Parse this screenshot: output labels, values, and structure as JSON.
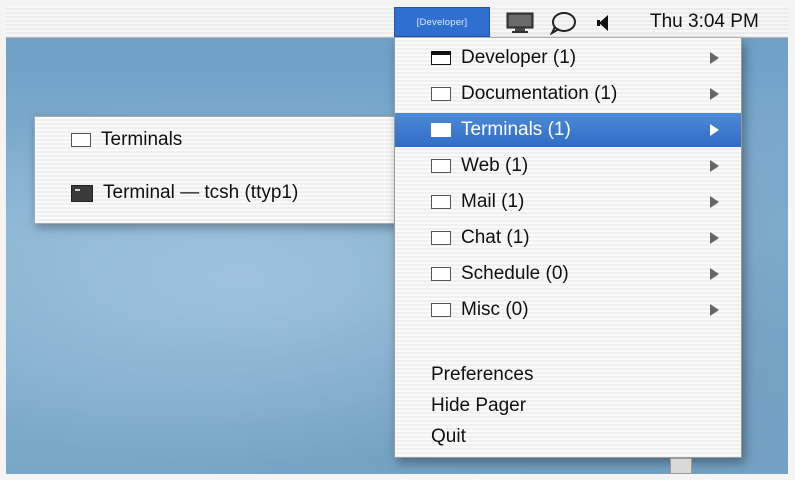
{
  "menubar": {
    "pager_label": "[Developer]",
    "clock": "Thu 3:04 PM",
    "icons": [
      "display-icon",
      "speech-bubble-icon",
      "volume-icon"
    ]
  },
  "menu": {
    "items": [
      {
        "label": "Developer (1)",
        "icon": "window-active-icon",
        "has_submenu": true
      },
      {
        "label": "Documentation (1)",
        "icon": "window-icon",
        "has_submenu": true
      },
      {
        "label": "Terminals (1)",
        "icon": "window-icon",
        "has_submenu": true,
        "selected": true
      },
      {
        "label": "Web (1)",
        "icon": "window-icon",
        "has_submenu": true
      },
      {
        "label": "Mail (1)",
        "icon": "window-icon",
        "has_submenu": true
      },
      {
        "label": "Chat (1)",
        "icon": "window-icon",
        "has_submenu": true
      },
      {
        "label": "Schedule (0)",
        "icon": "window-icon",
        "has_submenu": true
      },
      {
        "label": "Misc (0)",
        "icon": "window-icon",
        "has_submenu": true
      }
    ],
    "actions": [
      "Preferences",
      "Hide Pager",
      "Quit"
    ]
  },
  "submenu": {
    "header": "Terminals",
    "items": [
      {
        "label": "Terminal — tcsh (ttyp1)",
        "icon": "terminal-icon"
      }
    ]
  },
  "colors": {
    "selection": "#3f7ccf",
    "desktop": "#7fa9c9",
    "pager_tag": "#2f6fd0"
  }
}
